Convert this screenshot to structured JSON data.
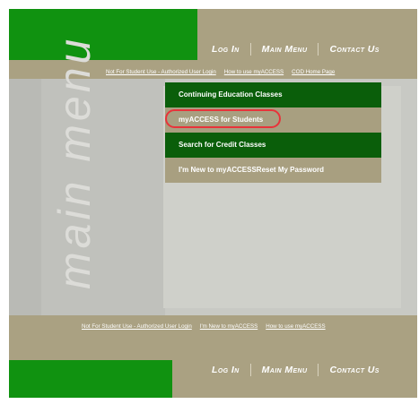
{
  "header": {
    "nav": [
      "Log In",
      "Main Menu",
      "Contact Us"
    ],
    "links": [
      "Not For Student Use - Authorized User Login",
      "How to use myACCESS",
      "COD Home Page"
    ]
  },
  "main": {
    "watermark": "main menu",
    "menu_items": [
      "Continuing Education Classes",
      "myACCESS for Students",
      "Search for Credit Classes",
      "I'm New to myACCESSReset My Password"
    ]
  },
  "footer": {
    "links": [
      "Not For Student Use - Authorized User Login",
      "I'm New to myACCESS",
      "How to use myACCESS"
    ],
    "nav": [
      "Log In",
      "Main Menu",
      "Contact Us"
    ]
  },
  "colors": {
    "brand_green": "#109210",
    "dark_green": "#0a5e0a",
    "tan": "#aaa182",
    "highlight_red": "#e8333a"
  }
}
